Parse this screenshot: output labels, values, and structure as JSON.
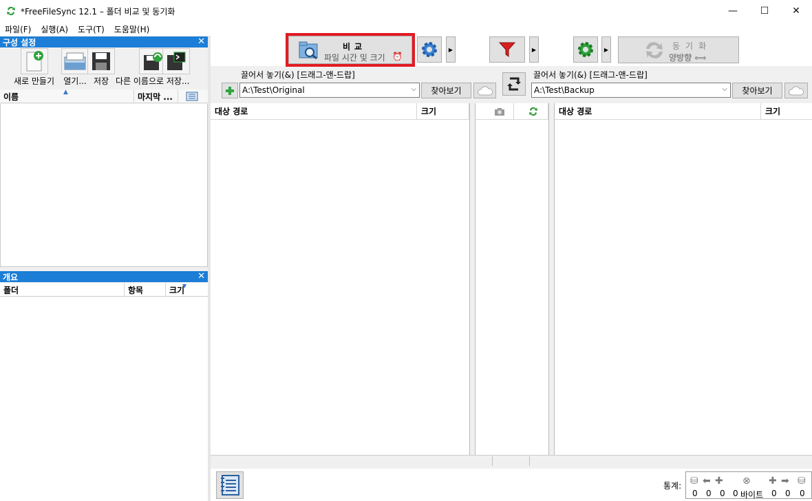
{
  "window": {
    "title": "*FreeFileSync 12.1 – 폴더 비교 및 동기화",
    "minimize": "—",
    "maximize": "☐",
    "close": "✕"
  },
  "menu": [
    "파일(F)",
    "실행(A)",
    "도구(T)",
    "도움말(H)"
  ],
  "config_panel": {
    "title": "구성 설정",
    "close": "✕",
    "tools": [
      {
        "label": "새로 만들기",
        "icon": "new-file-icon"
      },
      {
        "label": "열기...",
        "icon": "open-icon"
      },
      {
        "label": "저장",
        "icon": "save-icon"
      },
      {
        "label": "다른 이름으로 저장...",
        "icon": "save-as-icon"
      },
      {
        "label": "",
        "icon": "save-batch-icon"
      }
    ],
    "columns": {
      "name": "이름",
      "last": "마지막 ...",
      "menu_icon": "list-icon"
    }
  },
  "overview_panel": {
    "title": "개요",
    "close": "✕",
    "columns": {
      "folder": "폴더",
      "items": "항목",
      "size": "크기"
    }
  },
  "toolbar": {
    "compare_title": "비교",
    "compare_subtitle": "파일 시간 및 크기",
    "sync_title": "동기화",
    "sync_subtitle": "양방향 ⟺"
  },
  "left_folder": {
    "drop_label": "끌어서 놓기(&) [드래그-앤-드랍]",
    "path": "A:\\Test\\Original",
    "browse": "찾아보기"
  },
  "right_folder": {
    "drop_label": "끌어서 놓기(&) [드래그-앤-드랍]",
    "path": "A:\\Test\\Backup",
    "browse": "찾아보기"
  },
  "grid": {
    "left_path": "대상 경로",
    "left_size": "크기",
    "right_path": "대상 경로",
    "right_size": "크기"
  },
  "stats": {
    "label": "통계:",
    "values": [
      "0",
      "0",
      "0",
      "0",
      "0",
      "0",
      "0"
    ],
    "bytes": "바이트"
  },
  "colors": {
    "accent_blue": "#1c7ed6",
    "highlight_red": "#e21b23"
  }
}
